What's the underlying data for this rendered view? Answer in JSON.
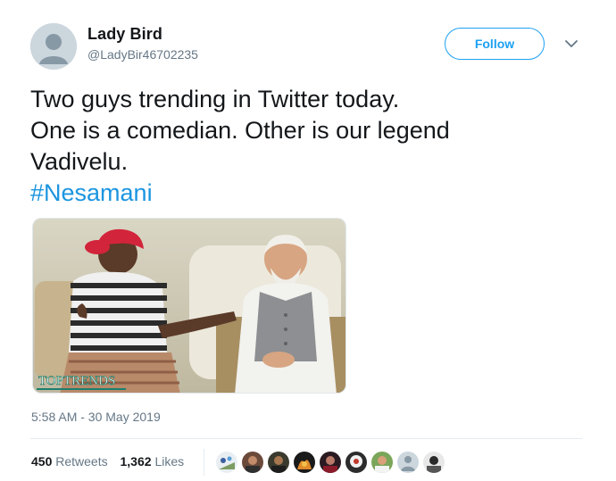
{
  "author": {
    "display_name": "Lady Bird",
    "handle": "@LadyBir46702235",
    "avatar_icon": "default-avatar-icon"
  },
  "header": {
    "follow_label": "Follow",
    "menu_icon": "chevron-down-icon"
  },
  "tweet": {
    "lines": [
      "Two guys trending in Twitter today.",
      "One is a comedian. Other is our legend",
      "Vadivelu."
    ],
    "hashtag": "#Nesamani",
    "media": {
      "watermark": "TOPTRENDS"
    },
    "timestamp": "5:58 AM - 30 May 2019"
  },
  "stats": {
    "retweets_count": "450",
    "retweets_label": "Retweets",
    "likes_count": "1,362",
    "likes_label": "Likes"
  },
  "colors": {
    "accent": "#1da1f2",
    "hashtag": "#1b95e0",
    "secondary_text": "#657786",
    "primary_text": "#14171a",
    "divider": "#e6ecf0"
  }
}
